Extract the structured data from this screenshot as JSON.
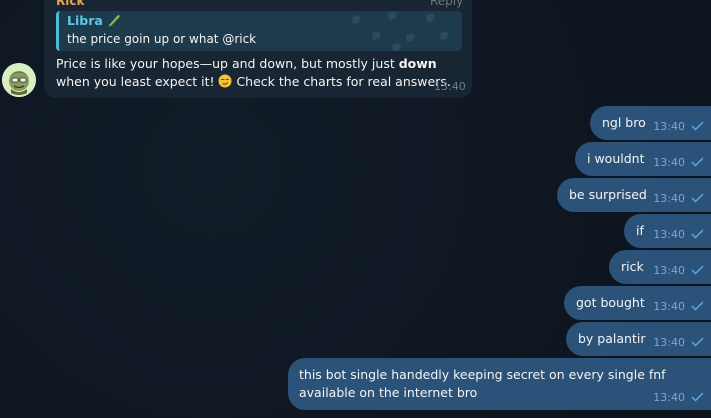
{
  "incoming": {
    "sender": "Rick",
    "reply_action": "Reply",
    "quote": {
      "author": "Libra",
      "emoji_icon": "parrot-icon",
      "text": "the price goin up or what @rick"
    },
    "text_before_bold": "Price is like your hopes—up and down, but mostly just ",
    "text_bold": "down",
    "text_after_bold_1": " when you least expect it! ",
    "text_after_emoji": " Check the charts for real answers.",
    "emoji_icon": "smirk-face-icon",
    "time": "13:40",
    "sender_color": "#e8a24f",
    "quote_accent": "#4fbcd4"
  },
  "outgoing": [
    {
      "text": "ngl bro",
      "time": "13:40"
    },
    {
      "text": "i wouldnt",
      "time": "13:40"
    },
    {
      "text": "be surprised",
      "time": "13:40"
    },
    {
      "text": "if",
      "time": "13:40"
    },
    {
      "text": "rick",
      "time": "13:40"
    },
    {
      "text": "got bought",
      "time": "13:40"
    },
    {
      "text": "by palantir",
      "time": "13:40"
    },
    {
      "text": "this bot single handedly keeping secret on every single fnf available on the internet bro",
      "time": "13:40"
    }
  ],
  "colors": {
    "background": "#0e1621",
    "incoming_bubble": "#182533",
    "outgoing_bubble": "#2b5278",
    "read_check": "#5fa8e8"
  }
}
